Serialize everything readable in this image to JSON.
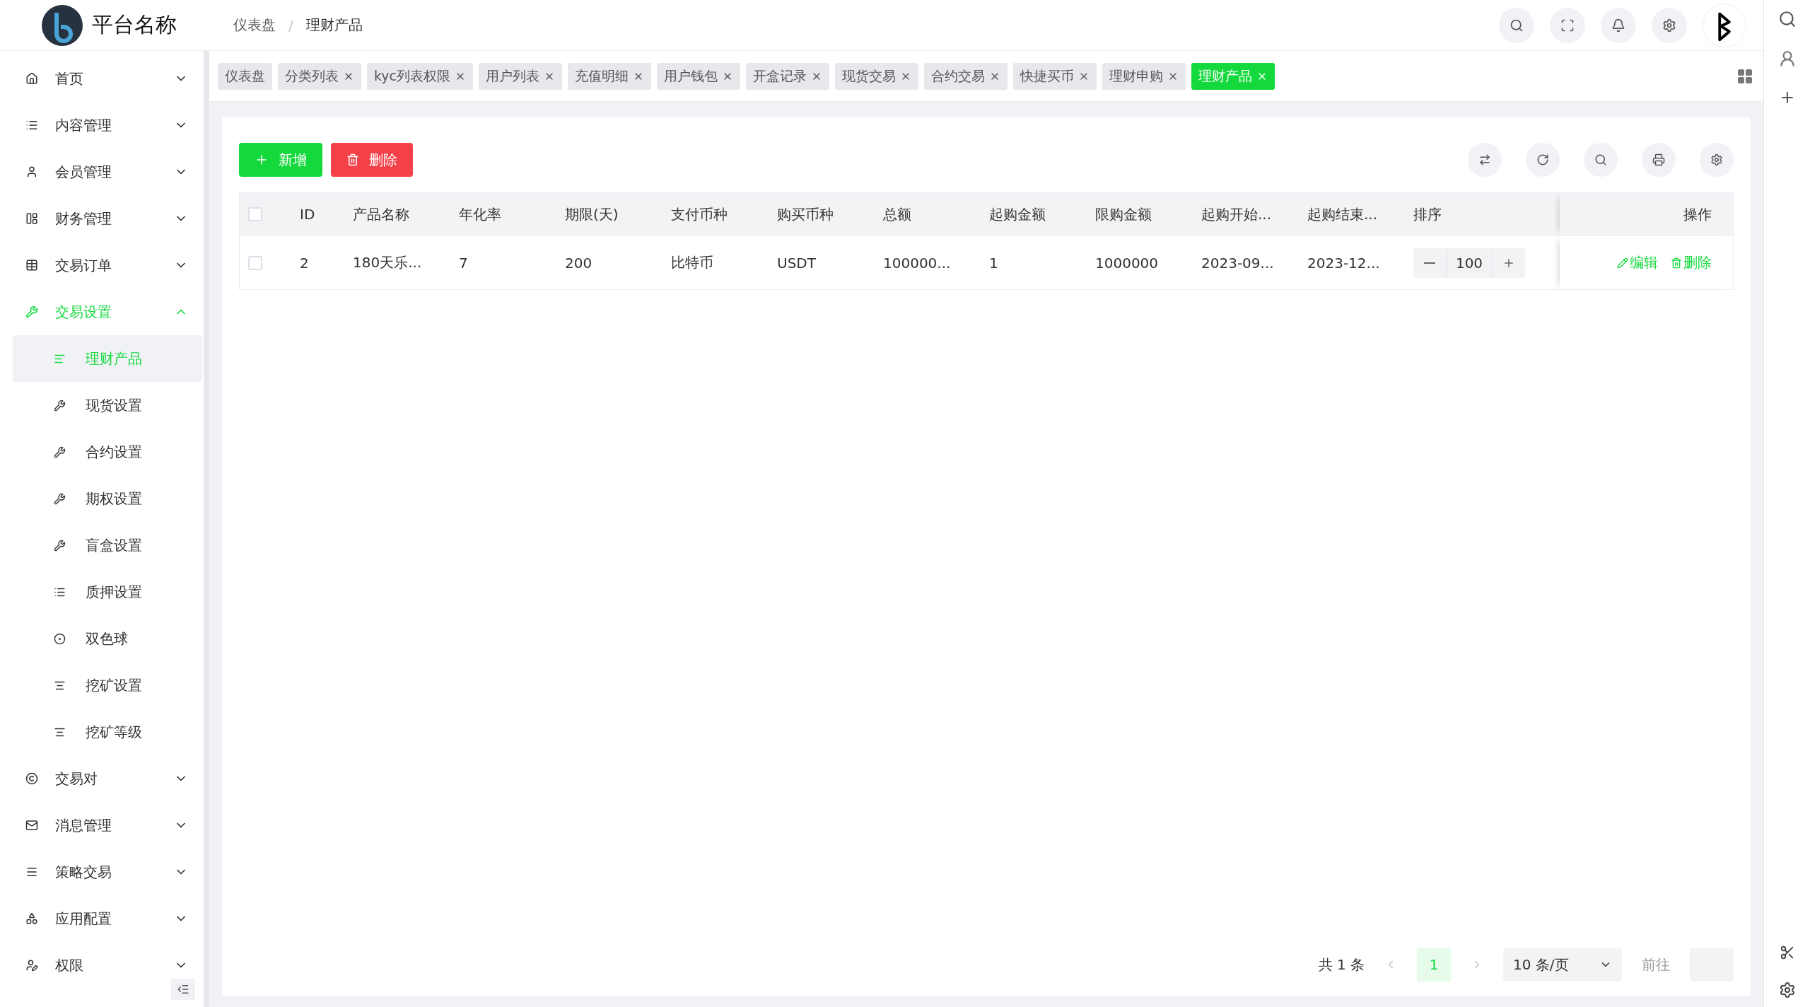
{
  "header": {
    "brand": "平台名称",
    "breadcrumb": [
      "仪表盘",
      "理财产品"
    ],
    "breadcrumb_separator": "/"
  },
  "tabs": [
    {
      "label": "仪表盘",
      "selected": false,
      "closable": false
    },
    {
      "label": "分类列表",
      "selected": false,
      "closable": true
    },
    {
      "label": "kyc列表权限",
      "selected": false,
      "closable": true
    },
    {
      "label": "用户列表",
      "selected": false,
      "closable": true
    },
    {
      "label": "充值明细",
      "selected": false,
      "closable": true
    },
    {
      "label": "用户钱包",
      "selected": false,
      "closable": true
    },
    {
      "label": "开盒记录",
      "selected": false,
      "closable": true
    },
    {
      "label": "现货交易",
      "selected": false,
      "closable": true
    },
    {
      "label": "合约交易",
      "selected": false,
      "closable": true
    },
    {
      "label": "快捷买币",
      "selected": false,
      "closable": true
    },
    {
      "label": "理财申购",
      "selected": false,
      "closable": true
    },
    {
      "label": "理财产品",
      "selected": true,
      "closable": true
    }
  ],
  "sidebar": {
    "items": [
      {
        "label": "首页",
        "expanded": false
      },
      {
        "label": "内容管理",
        "expanded": false
      },
      {
        "label": "会员管理",
        "expanded": false
      },
      {
        "label": "财务管理",
        "expanded": false
      },
      {
        "label": "交易订单",
        "expanded": false
      },
      {
        "label": "交易设置",
        "expanded": true,
        "children": [
          {
            "label": "理财产品",
            "selected": true
          },
          {
            "label": "现货设置",
            "selected": false
          },
          {
            "label": "合约设置",
            "selected": false
          },
          {
            "label": "期权设置",
            "selected": false
          },
          {
            "label": "盲盒设置",
            "selected": false
          },
          {
            "label": "质押设置",
            "selected": false
          },
          {
            "label": "双色球",
            "selected": false
          },
          {
            "label": "挖矿设置",
            "selected": false
          },
          {
            "label": "挖矿等级",
            "selected": false
          }
        ]
      },
      {
        "label": "交易对",
        "expanded": false
      },
      {
        "label": "消息管理",
        "expanded": false
      },
      {
        "label": "策略交易",
        "expanded": false
      },
      {
        "label": "应用配置",
        "expanded": false
      },
      {
        "label": "权限",
        "expanded": false
      }
    ]
  },
  "toolbar": {
    "add": "新增",
    "delete": "删除"
  },
  "table": {
    "columns": [
      "ID",
      "产品名称",
      "年化率",
      "期限(天)",
      "支付币种",
      "购买币种",
      "总额",
      "起购金额",
      "限购金额",
      "起购开始...",
      "起购结束...",
      "排序",
      "操作"
    ],
    "all_checked": false,
    "rows": [
      {
        "checked": false,
        "cells": [
          "2",
          "180天乐...",
          "7",
          "200",
          "比特币",
          "USDT",
          "100000...",
          "1",
          "1000000",
          "2023-09...",
          "2023-12..."
        ],
        "sort": "100",
        "actions": [
          "编辑",
          "删除"
        ]
      }
    ]
  },
  "pagination": {
    "total": "共 1 条",
    "pages": [
      {
        "label": "1",
        "selected": true
      }
    ],
    "page_size": "10 条/页",
    "goto": "前往"
  }
}
